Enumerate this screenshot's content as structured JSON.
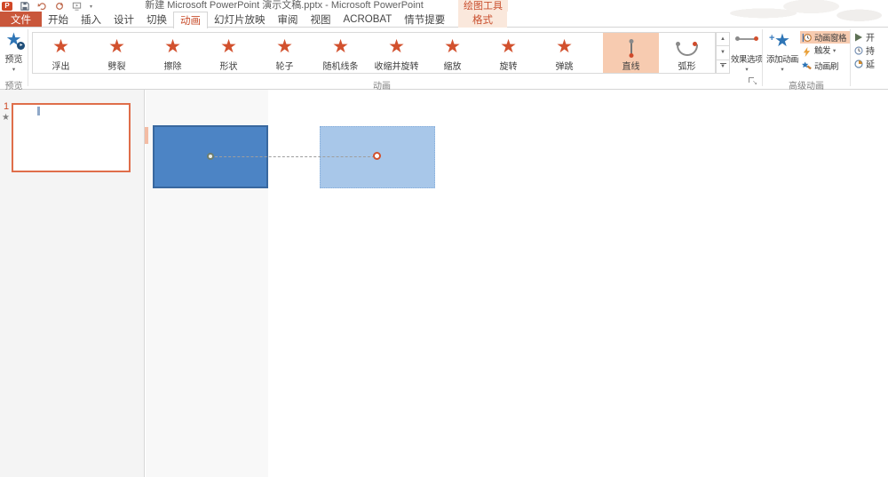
{
  "title_bar": {
    "title": "新建 Microsoft PowerPoint 演示文稿.pptx - Microsoft PowerPoint",
    "context_tool_label": "绘图工具"
  },
  "tabs": [
    {
      "label": "文件",
      "type": "file"
    },
    {
      "label": "开始",
      "type": "normal"
    },
    {
      "label": "插入",
      "type": "normal"
    },
    {
      "label": "设计",
      "type": "normal"
    },
    {
      "label": "切换",
      "type": "normal"
    },
    {
      "label": "动画",
      "type": "normal",
      "selected": true
    },
    {
      "label": "幻灯片放映",
      "type": "normal"
    },
    {
      "label": "审阅",
      "type": "normal"
    },
    {
      "label": "视图",
      "type": "normal"
    },
    {
      "label": "ACROBAT",
      "type": "normal"
    },
    {
      "label": "情节提要",
      "type": "normal"
    },
    {
      "label": "格式",
      "type": "contextual"
    }
  ],
  "ribbon": {
    "preview": {
      "button_label": "预览",
      "group_label": "预览"
    },
    "animation_group": {
      "group_label": "动画",
      "entrance_items": [
        {
          "label": "浮出",
          "icon": "star"
        },
        {
          "label": "劈裂",
          "icon": "star"
        },
        {
          "label": "擦除",
          "icon": "star"
        },
        {
          "label": "形状",
          "icon": "star"
        },
        {
          "label": "轮子",
          "icon": "star"
        },
        {
          "label": "随机线条",
          "icon": "star"
        },
        {
          "label": "收缩并旋转",
          "icon": "star"
        },
        {
          "label": "缩放",
          "icon": "star"
        },
        {
          "label": "旋转",
          "icon": "star"
        },
        {
          "label": "弹跳",
          "icon": "star"
        }
      ],
      "motion_items": [
        {
          "label": "直线",
          "icon": "line-path",
          "selected": true
        },
        {
          "label": "弧形",
          "icon": "arc-path"
        }
      ],
      "effect_options_label": "效果选项"
    },
    "advanced_group": {
      "group_label": "高级动画",
      "add_animation_label": "添加动画",
      "buttons": [
        {
          "label": "动画窗格",
          "icon": "animation-pane",
          "active": true
        },
        {
          "label": "触发",
          "icon": "trigger",
          "dropdown": true
        },
        {
          "label": "动画刷",
          "icon": "animation-painter"
        }
      ]
    },
    "timing_partial": [
      {
        "label": "开",
        "icon": "play"
      },
      {
        "label": "持",
        "icon": "clock"
      },
      {
        "label": "延",
        "icon": "delay"
      }
    ]
  },
  "slide_panel": {
    "slide_number": "1",
    "animation_indicator": "★"
  },
  "colors": {
    "accent_orange": "#C9502F",
    "file_tab": "#C9573B",
    "selection_peach": "#F7CBB0",
    "gallery_star": "#D2512E",
    "blue_star": "#2E75B6",
    "shape_fill": "#4C84C5",
    "ghost_fill": "#A8C7E9",
    "path_end": "#D2512E"
  }
}
